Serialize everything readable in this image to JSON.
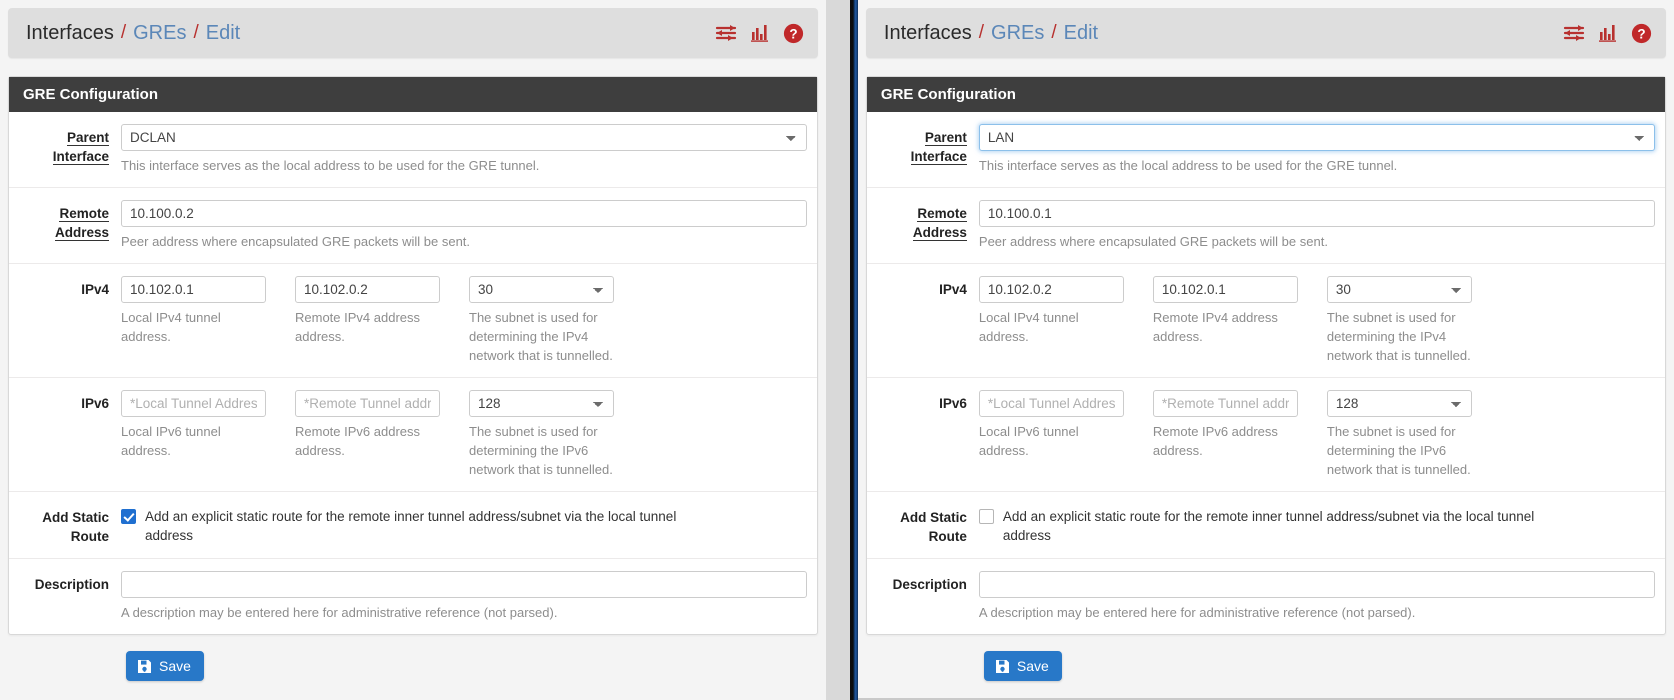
{
  "breadcrumb": {
    "root": "Interfaces",
    "separator": "/",
    "middle": "GREs",
    "current": "Edit"
  },
  "header_icons": [
    {
      "name": "sliders-icon",
      "title": "Advanced settings"
    },
    {
      "name": "bar-chart-icon",
      "title": "Status / graphs"
    },
    {
      "name": "help-circle-icon",
      "title": "Help"
    }
  ],
  "panel": {
    "title": "GRE Configuration"
  },
  "labels": {
    "parent_interface": "Parent Interface",
    "parent_interface_l1": "Parent",
    "parent_interface_l2": "Interface",
    "remote_address": "Remote Address",
    "remote_address_l1": "Remote",
    "remote_address_l2": "Address",
    "ipv4": "IPv4",
    "ipv6": "IPv6",
    "add_static_route": "Add Static Route",
    "add_static_route_l1": "Add Static",
    "add_static_route_l2": "Route",
    "description": "Description"
  },
  "help_text": {
    "parent_interface": "This interface serves as the local address to be used for the GRE tunnel.",
    "remote_address": "Peer address where encapsulated GRE packets will be sent.",
    "ipv4_local": "Local IPv4 tunnel address.",
    "ipv4_remote": "Remote IPv4 address address.",
    "ipv4_subnet": "The subnet is used for determining the IPv4 network that is tunnelled.",
    "ipv6_local": "Local IPv6 tunnel address.",
    "ipv6_remote": "Remote IPv6 address address.",
    "ipv6_subnet": "The subnet is used for determining the IPv6 network that is tunnelled.",
    "description": "A description may be entered here for administrative reference (not parsed)."
  },
  "static_route_text": "Add an explicit static route for the remote inner tunnel address/subnet via the local tunnel address",
  "placeholders": {
    "ipv6_local": "*Local Tunnel Address",
    "ipv6_remote": "*Remote Tunnel addres",
    "description": ""
  },
  "save": {
    "label": "Save",
    "icon": "floppy-disk-icon"
  },
  "colors": {
    "panel_header_bg": "#3e3e3e",
    "breadcrumb_bg": "#dedede",
    "link": "#5b87b8",
    "separator": "#b8312f",
    "icon_red": "#b8312f",
    "save_blue": "#2878c8",
    "checkbox_blue": "#1f6fd0",
    "focus_border": "#8cc0ea"
  },
  "panes": {
    "left": {
      "parent_interface_value": "DCLAN",
      "parent_interface_focused": false,
      "remote_address_value": "10.100.0.2",
      "ipv4_local_value": "10.102.0.1",
      "ipv4_remote_value": "10.102.0.2",
      "ipv4_subnet_value": "30",
      "ipv6_local_value": "",
      "ipv6_remote_value": "",
      "ipv6_subnet_value": "128",
      "add_static_route_checked": true,
      "description_value": ""
    },
    "right": {
      "parent_interface_value": "LAN",
      "parent_interface_focused": true,
      "remote_address_value": "10.100.0.1",
      "ipv4_local_value": "10.102.0.2",
      "ipv4_remote_value": "10.102.0.1",
      "ipv4_subnet_value": "30",
      "ipv6_local_value": "",
      "ipv6_remote_value": "",
      "ipv6_subnet_value": "128",
      "add_static_route_checked": false,
      "description_value": ""
    }
  }
}
